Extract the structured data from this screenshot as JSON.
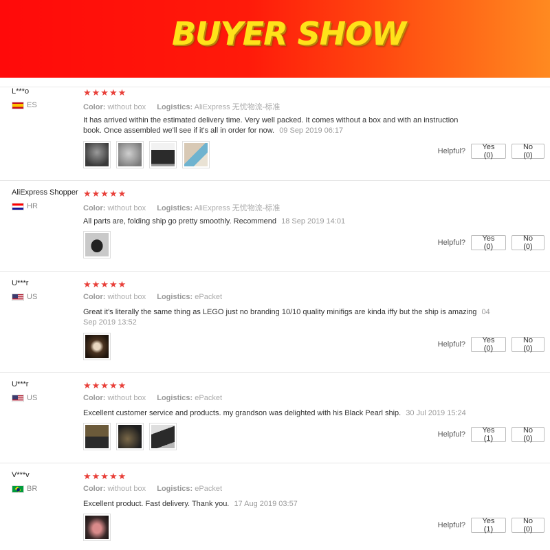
{
  "banner": {
    "title": "BUYER SHOW"
  },
  "colors": {
    "banner_red": "#ff0a0a",
    "banner_orange": "#ff8a20",
    "banner_text": "#ffe21a",
    "star": "#e8403a"
  },
  "labels": {
    "color": "Color:",
    "logistics": "Logistics:",
    "helpful": "Helpful?"
  },
  "reviews": [
    {
      "name": "L***o",
      "country": "ES",
      "flag": "flag-es-icon",
      "stars": "★★★★★",
      "color": "without box",
      "logistics": "AliExpress 无忧物流-标准",
      "text": "It has arrived within the estimated delivery time. Very well packed. It comes without a box and with an instruction book. Once assembled we'll see if it's all in order for now.",
      "date": "09 Sep 2019 06:17",
      "yes": "Yes (0)",
      "no": "No (0)"
    },
    {
      "name": "AliExpress Shopper",
      "country": "HR",
      "flag": "flag-hr-icon",
      "stars": "★★★★★",
      "color": "without box",
      "logistics": "AliExpress 无忧物流-标准",
      "text": "All parts are, folding ship go pretty smoothly. Recommend",
      "date": "18 Sep 2019 14:01",
      "yes": "Yes (0)",
      "no": "No (0)"
    },
    {
      "name": "U***r",
      "country": "US",
      "flag": "flag-us-icon",
      "stars": "★★★★★",
      "color": "without box",
      "logistics": "ePacket",
      "text": "Great it's literally the same thing as LEGO just no branding 10/10 quality minifigs are kinda iffy but the ship is amazing",
      "date": "04 Sep 2019 13:52",
      "yes": "Yes (0)",
      "no": "No (0)"
    },
    {
      "name": "U***r",
      "country": "US",
      "flag": "flag-us-icon",
      "stars": "★★★★★",
      "color": "without box",
      "logistics": "ePacket",
      "text": "Excellent customer service and products. my grandson was delighted with his Black Pearl ship.",
      "date": "30 Jul 2019 15:24",
      "yes": "Yes (1)",
      "no": "No (0)"
    },
    {
      "name": "V***v",
      "country": "BR",
      "flag": "flag-br-icon",
      "stars": "★★★★★",
      "color": "without box",
      "logistics": "ePacket",
      "text": "Excellent product. Fast delivery. Thank you.",
      "date": "17 Aug 2019 03:57",
      "yes": "Yes (1)",
      "no": "No (0)"
    }
  ]
}
